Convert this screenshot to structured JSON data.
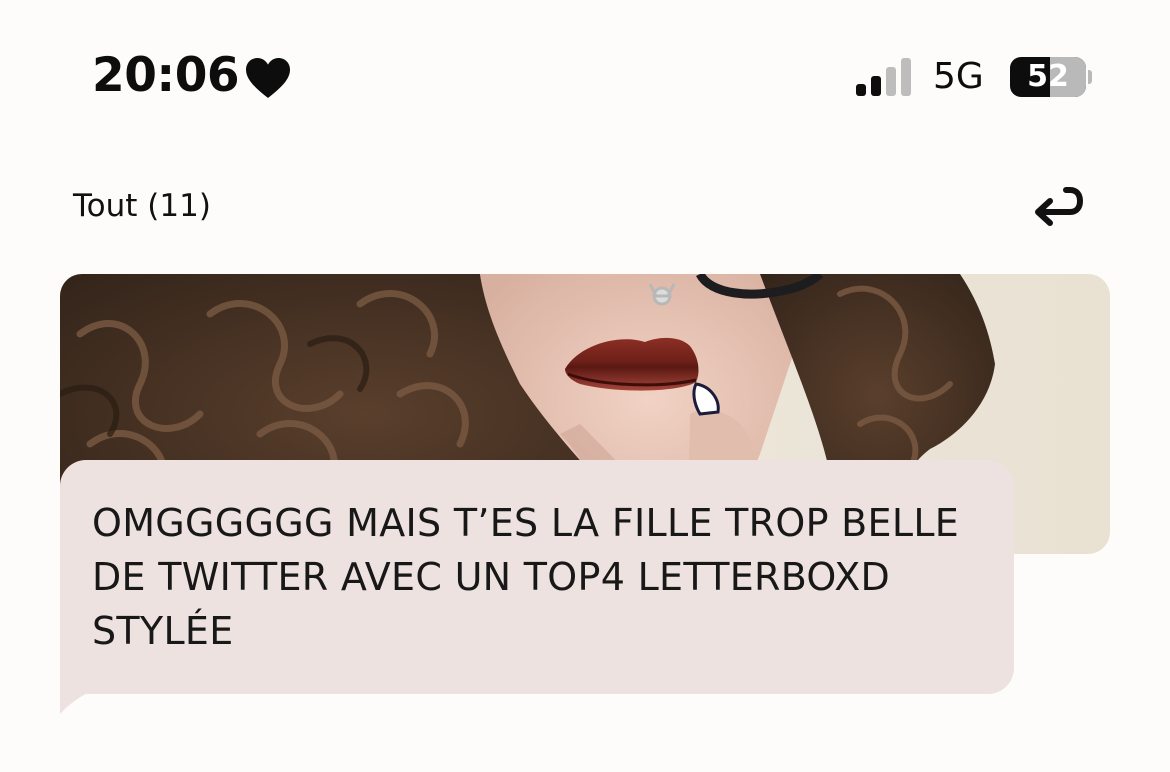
{
  "status_bar": {
    "time": "20:06",
    "heart_icon": "heart-icon",
    "signal_bars_active": 2,
    "signal_bars_total": 4,
    "network": "5G",
    "battery_percent": 52,
    "battery_label": "52"
  },
  "header": {
    "filter_label": "Tout (11)",
    "reply_icon": "reply-arrow-icon"
  },
  "message": {
    "photo_description_icon": "shared-photo",
    "text": "OMGGGGGG MAIS T’ES LA FILLE TROP BELLE DE TWITTER AVEC UN TOP4 LETTERBOXD STYLÉE",
    "bubble_color": "#ede2df"
  }
}
